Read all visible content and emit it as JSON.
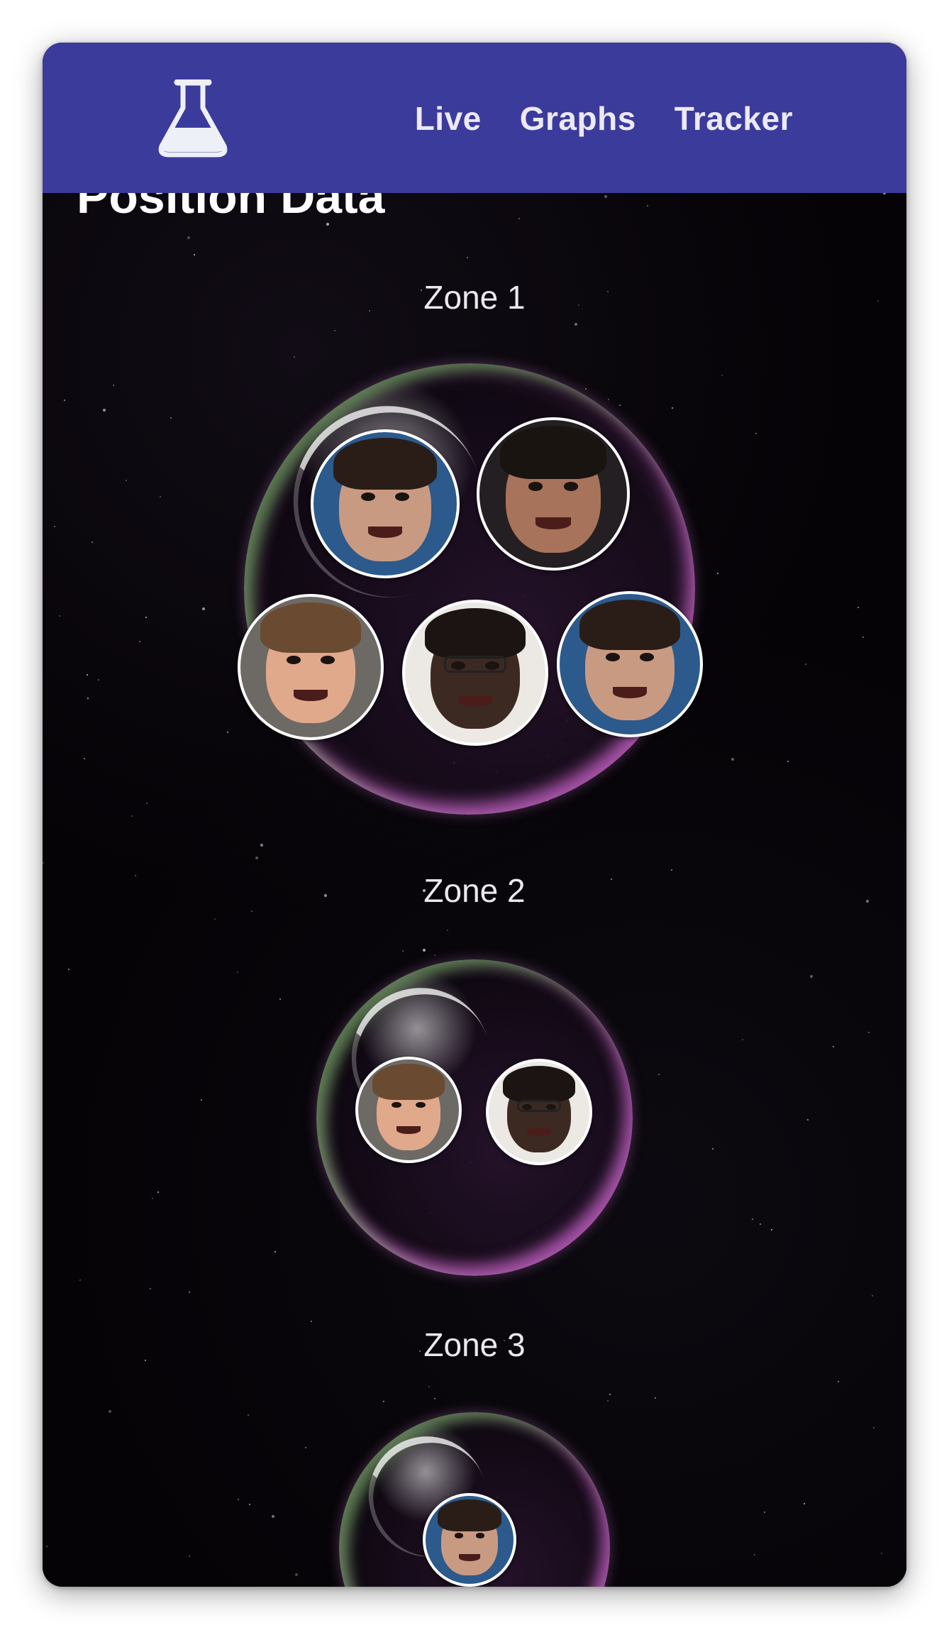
{
  "nav": {
    "logo_icon": "flask-icon",
    "links": [
      "Live",
      "Graphs",
      "Tracker"
    ],
    "background_color": "#3b3b9c"
  },
  "page": {
    "title": "Position Data"
  },
  "zones": [
    {
      "label": "Zone 1",
      "avatars": [
        {
          "person": "person-a",
          "bg": "#2c5a8c",
          "skin": "#c99a82",
          "hair": "#2a1d17"
        },
        {
          "person": "person-b",
          "bg": "#241f22",
          "skin": "#a8735b",
          "hair": "#1a1411"
        },
        {
          "person": "person-c",
          "bg": "#6d6a66",
          "skin": "#e0a98c",
          "hair": "#6b4a32"
        },
        {
          "person": "person-d",
          "bg": "#ece9e4",
          "skin": "#3c2a22",
          "hair": "#1b1412"
        },
        {
          "person": "person-a",
          "bg": "#2c5a8c",
          "skin": "#c99a82",
          "hair": "#2a1d17"
        }
      ]
    },
    {
      "label": "Zone 2",
      "avatars": [
        {
          "person": "person-c",
          "bg": "#6d6a66",
          "skin": "#e0a98c",
          "hair": "#6b4a32"
        },
        {
          "person": "person-d",
          "bg": "#ece9e4",
          "skin": "#3c2a22",
          "hair": "#1b1412"
        }
      ]
    },
    {
      "label": "Zone 3",
      "avatars": [
        {
          "person": "person-a",
          "bg": "#2c5a8c",
          "skin": "#c99a82",
          "hair": "#2a1d17"
        }
      ]
    }
  ]
}
